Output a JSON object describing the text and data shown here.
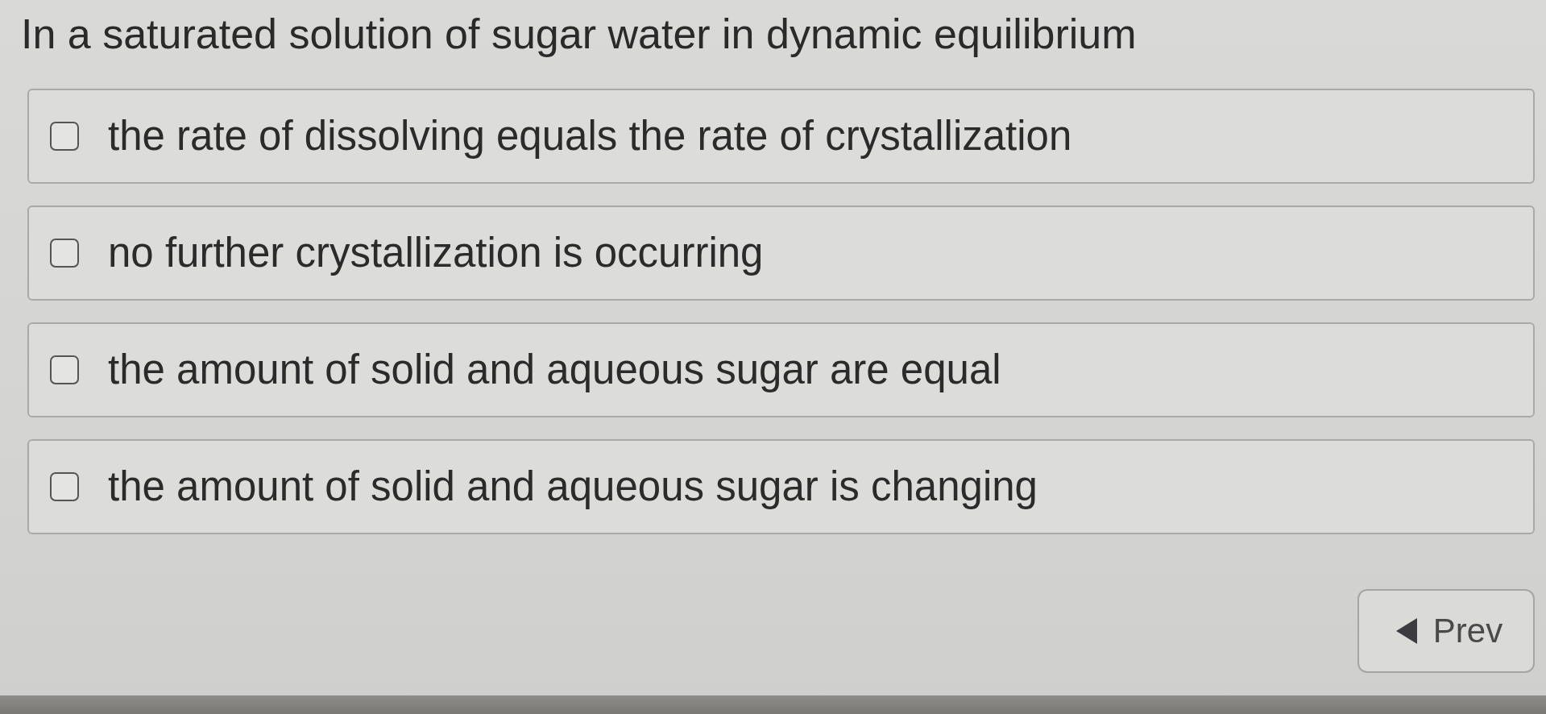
{
  "question": "In a saturated solution of sugar water in dynamic equilibrium",
  "options": [
    {
      "label": "the rate of dissolving equals the rate of crystallization",
      "checked": false
    },
    {
      "label": "no further crystallization is occurring",
      "checked": false
    },
    {
      "label": "the amount of solid and aqueous sugar are equal",
      "checked": false
    },
    {
      "label": "the amount of solid and aqueous sugar is changing",
      "checked": false
    }
  ],
  "prev_button": {
    "label": "Prev"
  }
}
